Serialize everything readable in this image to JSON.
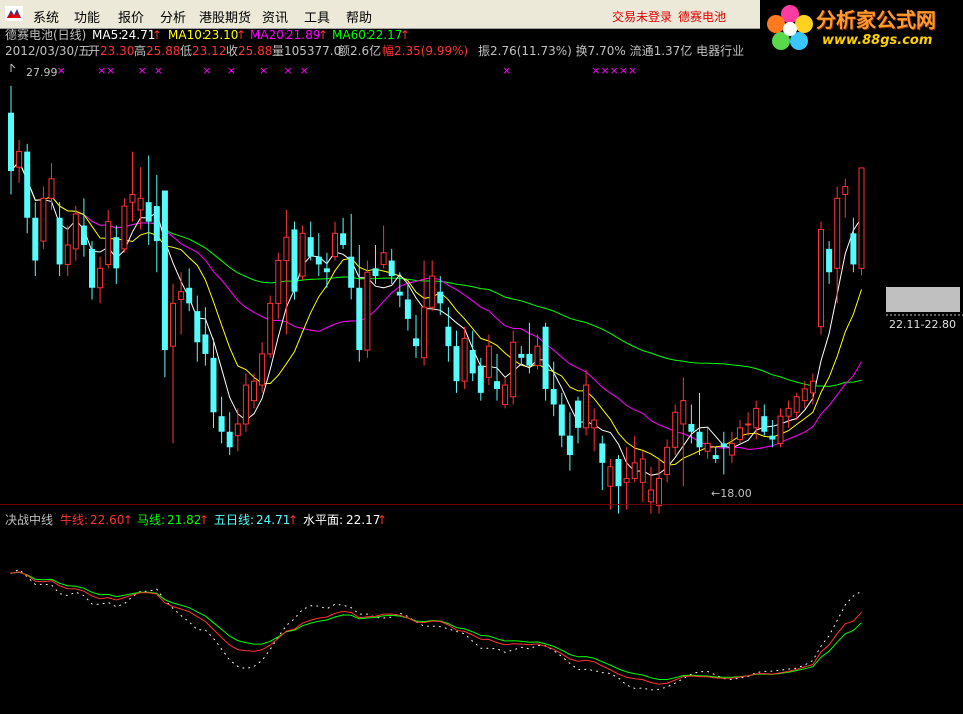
{
  "menu": [
    "系统",
    "功能",
    "报价",
    "分析",
    "港股期货",
    "资讯",
    "工具",
    "帮助"
  ],
  "status": {
    "login": "交易未登录",
    "stock": "德赛电池"
  },
  "watermark": {
    "title": "分析家公式网",
    "url": "www.88gs.com"
  },
  "colors": {
    "up": "#ff3232",
    "down": "#54fcfc",
    "ma5": "#ffffff",
    "ma10": "#ffff00",
    "ma20": "#ff00ff",
    "ma60": "#00ff00",
    "cow": "#ff3232",
    "horse": "#00ff00",
    "five": "#54fcfc",
    "water": "#ffffff",
    "grid": "#6e0000"
  },
  "chart_data": [
    {
      "type": "candlestick",
      "header": {
        "name": "德赛电池(日线)",
        "ma": [
          {
            "label": "MA5:",
            "value": "24.71"
          },
          {
            "label": "MA10:",
            "value": "23.10"
          },
          {
            "label": "MA20:",
            "value": "21.89"
          },
          {
            "label": "MA60:",
            "value": "22.17"
          }
        ],
        "date": "2012/03/30/五",
        "fields": [
          {
            "label": "开",
            "value": "23.30"
          },
          {
            "label": "高",
            "value": "25.88"
          },
          {
            "label": "低",
            "value": "23.12"
          },
          {
            "label": "收",
            "value": "25.88"
          },
          {
            "label": "量",
            "value": "105377.0"
          },
          {
            "label": "额",
            "value": "2.6亿"
          },
          {
            "label": "幅",
            "value": "2.35(9.99%)"
          }
        ],
        "tail": "振2.76(11.73%) 换7.70% 流通1.37亿 电器行业"
      },
      "high_label": "27.99",
      "low_label": "←18.00",
      "price_marker": "22.11-22.80",
      "price_range": [
        17.5,
        28.5
      ],
      "markers": [
        {
          "pos": 6,
          "text": "×"
        },
        {
          "pos": 11,
          "text": "××"
        },
        {
          "pos": 16,
          "text": "×"
        },
        {
          "pos": 18,
          "text": "×"
        },
        {
          "pos": 24,
          "text": "×"
        },
        {
          "pos": 27,
          "text": "×"
        },
        {
          "pos": 31,
          "text": "×"
        },
        {
          "pos": 34,
          "text": "×"
        },
        {
          "pos": 36,
          "text": "×"
        },
        {
          "pos": 61,
          "text": "×"
        },
        {
          "pos": 72,
          "text": "×××××"
        }
      ],
      "candles": [
        [
          27.3,
          27.99,
          25.2,
          25.8
        ],
        [
          25.9,
          26.6,
          25.5,
          26.3
        ],
        [
          26.3,
          26.5,
          24.2,
          24.6
        ],
        [
          24.6,
          25.0,
          23.1,
          23.5
        ],
        [
          24.0,
          25.4,
          23.8,
          25.1
        ],
        [
          25.1,
          26.0,
          24.8,
          25.6
        ],
        [
          24.6,
          25.0,
          23.1,
          23.4
        ],
        [
          23.4,
          24.4,
          23.1,
          23.9
        ],
        [
          23.8,
          24.9,
          23.5,
          24.7
        ],
        [
          24.4,
          25.1,
          23.6,
          23.9
        ],
        [
          23.8,
          24.0,
          22.5,
          22.8
        ],
        [
          22.8,
          23.6,
          22.4,
          23.3
        ],
        [
          23.4,
          24.8,
          23.3,
          24.5
        ],
        [
          24.1,
          24.4,
          22.9,
          23.3
        ],
        [
          23.8,
          25.1,
          23.7,
          24.9
        ],
        [
          25.0,
          26.3,
          24.5,
          25.2
        ],
        [
          24.8,
          25.9,
          24.3,
          25.1
        ],
        [
          25.0,
          26.2,
          23.9,
          24.5
        ],
        [
          24.9,
          25.7,
          23.2,
          24.0
        ],
        [
          25.3,
          25.3,
          20.5,
          21.2
        ],
        [
          21.3,
          22.9,
          18.8,
          22.4
        ],
        [
          22.5,
          23.2,
          21.6,
          22.7
        ],
        [
          22.8,
          23.3,
          22.2,
          22.4
        ],
        [
          22.2,
          22.6,
          20.9,
          21.4
        ],
        [
          21.6,
          22.3,
          20.8,
          21.1
        ],
        [
          21.0,
          21.5,
          19.2,
          19.6
        ],
        [
          19.5,
          20.0,
          18.8,
          19.1
        ],
        [
          19.1,
          19.6,
          18.5,
          18.7
        ],
        [
          19.0,
          19.7,
          18.6,
          19.3
        ],
        [
          19.3,
          20.6,
          19.1,
          20.3
        ],
        [
          19.9,
          20.6,
          19.7,
          20.4
        ],
        [
          20.3,
          21.4,
          20.1,
          21.1
        ],
        [
          21.1,
          22.6,
          21.0,
          22.4
        ],
        [
          22.4,
          23.7,
          22.0,
          23.5
        ],
        [
          23.5,
          24.8,
          21.6,
          24.1
        ],
        [
          24.3,
          24.5,
          22.5,
          22.7
        ],
        [
          23.1,
          24.4,
          23.0,
          24.2
        ],
        [
          24.1,
          24.5,
          23.5,
          23.6
        ],
        [
          23.6,
          24.2,
          23.1,
          23.4
        ],
        [
          23.3,
          23.7,
          22.8,
          23.2
        ],
        [
          23.6,
          24.5,
          23.5,
          24.2
        ],
        [
          24.2,
          24.6,
          23.8,
          23.9
        ],
        [
          23.6,
          24.7,
          22.5,
          22.8
        ],
        [
          22.8,
          23.9,
          20.9,
          21.2
        ],
        [
          21.2,
          23.5,
          21.0,
          23.2
        ],
        [
          23.3,
          23.9,
          22.9,
          23.1
        ],
        [
          23.4,
          24.4,
          23.3,
          23.7
        ],
        [
          23.5,
          23.8,
          22.9,
          23.1
        ],
        [
          22.7,
          23.2,
          22.3,
          22.6
        ],
        [
          22.5,
          22.9,
          21.7,
          22.0
        ],
        [
          21.5,
          22.1,
          21.0,
          21.3
        ],
        [
          21.0,
          23.5,
          20.8,
          22.3
        ],
        [
          22.3,
          23.5,
          22.2,
          23.1
        ],
        [
          22.7,
          23.1,
          22.1,
          22.4
        ],
        [
          21.8,
          22.3,
          20.9,
          21.3
        ],
        [
          21.3,
          21.7,
          20.1,
          20.4
        ],
        [
          20.4,
          21.8,
          20.2,
          21.5
        ],
        [
          21.2,
          21.7,
          20.4,
          20.6
        ],
        [
          20.8,
          21.0,
          19.9,
          20.1
        ],
        [
          20.5,
          21.6,
          20.3,
          21.3
        ],
        [
          20.4,
          21.1,
          19.9,
          20.2
        ],
        [
          19.8,
          20.5,
          19.7,
          20.3
        ],
        [
          20.0,
          21.7,
          19.8,
          21.4
        ],
        [
          21.1,
          21.3,
          20.8,
          21.0
        ],
        [
          21.1,
          21.9,
          20.6,
          20.8
        ],
        [
          20.8,
          21.6,
          20.7,
          21.3
        ],
        [
          21.8,
          21.9,
          19.9,
          20.2
        ],
        [
          20.2,
          20.9,
          19.5,
          19.8
        ],
        [
          19.8,
          20.1,
          18.7,
          19.0
        ],
        [
          19.0,
          19.6,
          18.1,
          18.5
        ],
        [
          19.9,
          20.0,
          18.8,
          19.2
        ],
        [
          19.2,
          20.7,
          19.0,
          20.3
        ],
        [
          19.2,
          19.7,
          18.6,
          19.4
        ],
        [
          18.8,
          19.0,
          17.6,
          18.3
        ],
        [
          17.7,
          18.4,
          17.1,
          18.2
        ],
        [
          18.4,
          18.5,
          17.0,
          17.7
        ],
        [
          17.8,
          18.7,
          17.1,
          17.9
        ],
        [
          17.9,
          19.0,
          17.8,
          18.3
        ],
        [
          17.8,
          18.6,
          17.3,
          18.4
        ],
        [
          17.3,
          18.2,
          17.0,
          17.6
        ],
        [
          17.2,
          18.4,
          17.0,
          17.9
        ],
        [
          18.0,
          18.9,
          17.8,
          18.7
        ],
        [
          18.7,
          19.8,
          18.5,
          19.6
        ],
        [
          19.3,
          20.5,
          17.7,
          19.9
        ],
        [
          19.3,
          19.8,
          18.8,
          19.1
        ],
        [
          19.1,
          20.1,
          18.5,
          18.7
        ],
        [
          18.6,
          19.2,
          18.4,
          18.8
        ],
        [
          18.5,
          18.7,
          18.3,
          18.4
        ],
        [
          18.8,
          19.1,
          18.0,
          18.7
        ],
        [
          18.5,
          19.1,
          18.3,
          18.8
        ],
        [
          18.9,
          19.4,
          18.8,
          19.2
        ],
        [
          19.3,
          19.6,
          19.0,
          19.3
        ],
        [
          19.2,
          19.9,
          18.9,
          19.7
        ],
        [
          19.5,
          19.8,
          19.0,
          19.1
        ],
        [
          19.0,
          19.4,
          18.7,
          18.9
        ],
        [
          18.8,
          19.7,
          18.7,
          19.5
        ],
        [
          19.5,
          19.9,
          19.2,
          19.7
        ],
        [
          19.6,
          20.1,
          19.4,
          20.0
        ],
        [
          19.9,
          20.4,
          19.7,
          20.2
        ],
        [
          20.1,
          20.6,
          19.8,
          20.4
        ],
        [
          21.8,
          24.5,
          21.6,
          24.3
        ],
        [
          23.8,
          24.0,
          22.9,
          23.2
        ],
        [
          23.3,
          25.4,
          22.4,
          25.1
        ],
        [
          25.2,
          25.6,
          24.6,
          25.4
        ],
        [
          24.2,
          24.6,
          23.2,
          23.4
        ],
        [
          23.3,
          25.88,
          23.12,
          25.88
        ]
      ]
    },
    {
      "type": "line",
      "title": "决战中线",
      "legend": [
        {
          "label": "牛线:",
          "value": "22.60"
        },
        {
          "label": "马线:",
          "value": "21.82"
        },
        {
          "label": "五日线:",
          "value": "24.71"
        },
        {
          "label": "水平面:",
          "value": "22.17"
        }
      ],
      "range": [
        16.5,
        28.5
      ]
    }
  ]
}
